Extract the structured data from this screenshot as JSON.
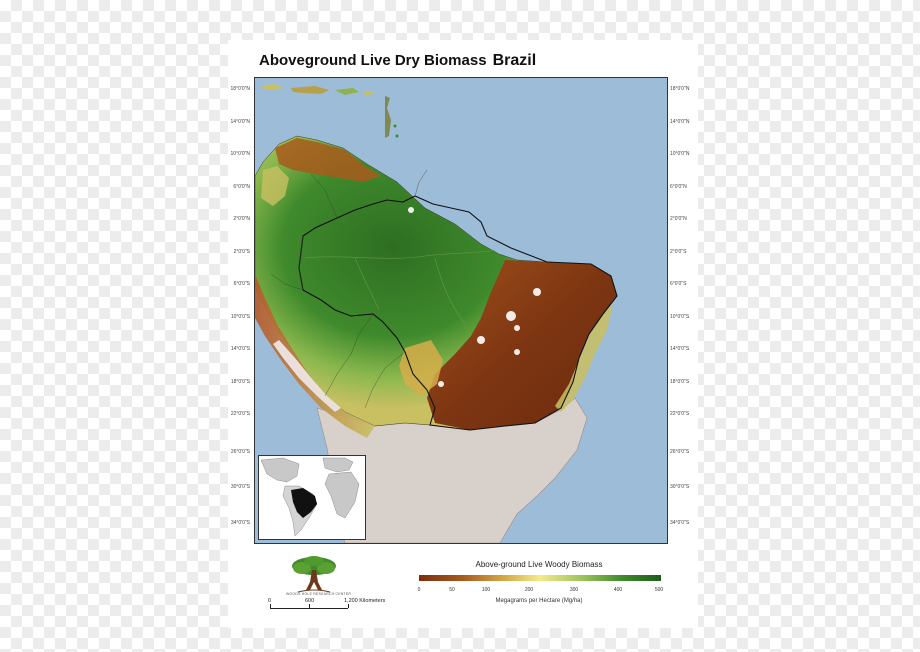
{
  "title": "Aboveground Live Dry Biomass",
  "region": "Brazil",
  "latitude_labels": [
    "18°0'0\"N",
    "14°0'0\"N",
    "10°0'0\"N",
    "6°0'0\"N",
    "2°0'0\"N",
    "2°0'0\"S",
    "6°0'0\"S",
    "10°0'0\"S",
    "14°0'0\"S",
    "18°0'0\"S",
    "22°0'0\"S",
    "26°0'0\"S",
    "30°0'0\"S",
    "34°0'0\"S"
  ],
  "legend": {
    "title": "Above-ground Live Woody Biomass",
    "ticks": [
      "0",
      "50",
      "100",
      "200",
      "300",
      "400",
      "500"
    ],
    "units": "Megagrams per Hectare (Mg/ha)"
  },
  "scale_bar": {
    "labels": [
      "0",
      "600",
      "1,200 Kilometers"
    ]
  },
  "logo_text": "WOODS HOLE RESEARCH CENTER",
  "colors": {
    "ocean": "#9dbcd8",
    "land": "#d8d0ca",
    "high_biomass": "#2e6e22",
    "medium_biomass": "#c9c062",
    "low_biomass": "#7a2e10",
    "brazil_inset": "#111111"
  }
}
